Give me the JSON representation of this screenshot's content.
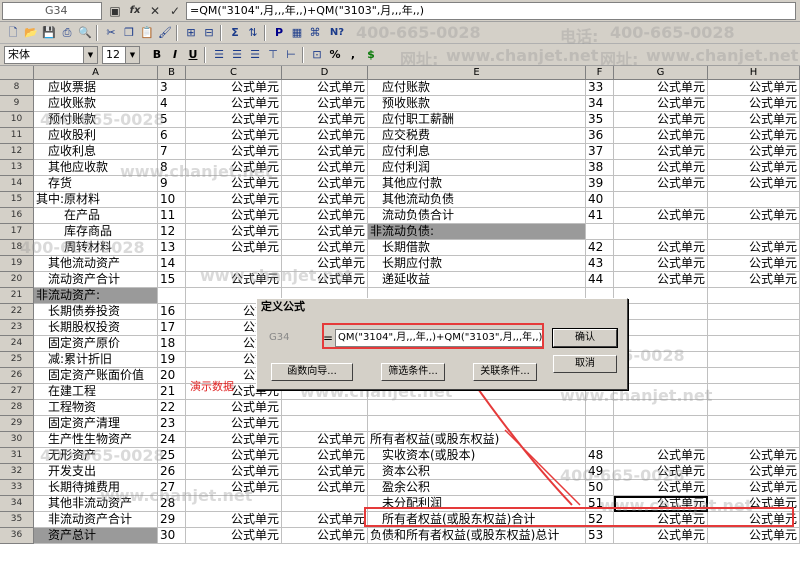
{
  "formula_bar": {
    "cell_ref": "G34",
    "fx_label": "fx",
    "cancel_label": "✕",
    "confirm_label": "✓",
    "formula": "=QM(\"3104\",月,,,年,,)+QM(\"3103\",月,,,年,,)"
  },
  "toolbar": {
    "font_name": "宋体",
    "font_size": "12",
    "bold": "B",
    "italic": "I",
    "underline": "U",
    "percent": "%",
    "comma": ",",
    "currency": "$",
    "sum": "Σ",
    "print_p": "P",
    "help": "N?"
  },
  "watermark": {
    "phone": "400-665-0028",
    "phone_label": "电话:",
    "site_label": "网址:",
    "site": "www.chanjet.net"
  },
  "columns": [
    "A",
    "B",
    "C",
    "D",
    "E",
    "F",
    "G",
    "H"
  ],
  "rows": [
    {
      "n": "8",
      "a": "应收票据",
      "ai": 1,
      "b": "3",
      "c": "公式单元",
      "d": "公式单元",
      "e": "应付账款",
      "ei": 1,
      "f": "33",
      "g": "公式单元",
      "h": "公式单元"
    },
    {
      "n": "9",
      "a": "应收账款",
      "ai": 1,
      "b": "4",
      "c": "公式单元",
      "d": "公式单元",
      "e": "预收账款",
      "ei": 1,
      "f": "34",
      "g": "公式单元",
      "h": "公式单元"
    },
    {
      "n": "10",
      "a": "预付账款",
      "ai": 1,
      "b": "5",
      "c": "公式单元",
      "d": "公式单元",
      "e": "应付职工薪酬",
      "ei": 1,
      "f": "35",
      "g": "公式单元",
      "h": "公式单元"
    },
    {
      "n": "11",
      "a": "应收股利",
      "ai": 1,
      "b": "6",
      "c": "公式单元",
      "d": "公式单元",
      "e": "应交税费",
      "ei": 1,
      "f": "36",
      "g": "公式单元",
      "h": "公式单元"
    },
    {
      "n": "12",
      "a": "应收利息",
      "ai": 1,
      "b": "7",
      "c": "公式单元",
      "d": "公式单元",
      "e": "应付利息",
      "ei": 1,
      "f": "37",
      "g": "公式单元",
      "h": "公式单元"
    },
    {
      "n": "13",
      "a": "其他应收款",
      "ai": 1,
      "b": "8",
      "c": "公式单元",
      "d": "公式单元",
      "e": "应付利润",
      "ei": 1,
      "f": "38",
      "g": "公式单元",
      "h": "公式单元"
    },
    {
      "n": "14",
      "a": "存货",
      "ai": 1,
      "b": "9",
      "c": "公式单元",
      "d": "公式单元",
      "e": "其他应付款",
      "ei": 1,
      "f": "39",
      "g": "公式单元",
      "h": "公式单元"
    },
    {
      "n": "15",
      "a": "其中:原材料",
      "ai": 0,
      "b": "10",
      "c": "公式单元",
      "d": "公式单元",
      "e": "其他流动负债",
      "ei": 1,
      "f": "40",
      "g": "",
      "h": ""
    },
    {
      "n": "16",
      "a": "在产品",
      "ai": 2,
      "b": "11",
      "c": "公式单元",
      "d": "公式单元",
      "e": "流动负债合计",
      "ei": 1,
      "f": "41",
      "g": "公式单元",
      "h": "公式单元"
    },
    {
      "n": "17",
      "a": "库存商品",
      "ai": 2,
      "b": "12",
      "c": "公式单元",
      "d": "公式单元",
      "e": "非流动负债:",
      "ei": 0,
      "eg": true,
      "f": "",
      "g": "",
      "h": ""
    },
    {
      "n": "18",
      "a": "周转材料",
      "ai": 2,
      "b": "13",
      "c": "公式单元",
      "d": "公式单元",
      "e": "长期借款",
      "ei": 1,
      "f": "42",
      "g": "公式单元",
      "h": "公式单元"
    },
    {
      "n": "19",
      "a": "其他流动资产",
      "ai": 1,
      "b": "14",
      "c": "",
      "d": "公式单元",
      "e": "长期应付款",
      "ei": 1,
      "f": "43",
      "g": "公式单元",
      "h": "公式单元"
    },
    {
      "n": "20",
      "a": "流动资产合计",
      "ai": 1,
      "b": "15",
      "c": "公式单元",
      "d": "公式单元",
      "e": "递延收益",
      "ei": 1,
      "f": "44",
      "g": "公式单元",
      "h": "公式单元"
    },
    {
      "n": "21",
      "a": "非流动资产:",
      "ai": 0,
      "ag": true,
      "b": "",
      "c": "",
      "d": "",
      "e": "",
      "ei": 0,
      "f": "",
      "g": "",
      "h": ""
    },
    {
      "n": "22",
      "a": "长期债券投资",
      "ai": 1,
      "b": "16",
      "c": "公式单",
      "d": "",
      "e": "",
      "ei": 0,
      "f": "",
      "g": "",
      "h": ""
    },
    {
      "n": "23",
      "a": "长期股权投资",
      "ai": 1,
      "b": "17",
      "c": "公式单",
      "d": "",
      "e": "",
      "ei": 0,
      "f": "",
      "g": "",
      "h": ""
    },
    {
      "n": "24",
      "a": "固定资产原价",
      "ai": 1,
      "b": "18",
      "c": "公式单",
      "d": "",
      "e": "",
      "ei": 0,
      "f": "",
      "g": "",
      "h": ""
    },
    {
      "n": "25",
      "a": "减:累计折旧",
      "ai": 1,
      "b": "19",
      "c": "公式单",
      "d": "",
      "e": "",
      "ei": 0,
      "f": "",
      "g": "",
      "h": ""
    },
    {
      "n": "26",
      "a": "固定资产账面价值",
      "ai": 1,
      "b": "20",
      "c": "公式单",
      "d": "",
      "e": "",
      "ei": 0,
      "f": "",
      "g": "",
      "h": ""
    },
    {
      "n": "27",
      "a": "在建工程",
      "ai": 1,
      "b": "21",
      "c": "公式单元",
      "d": "",
      "e": "",
      "ei": 0,
      "f": "",
      "g": "",
      "h": ""
    },
    {
      "n": "28",
      "a": "工程物资",
      "ai": 1,
      "b": "22",
      "c": "公式单元",
      "d": "",
      "e": "",
      "ei": 0,
      "f": "",
      "g": "",
      "h": ""
    },
    {
      "n": "29",
      "a": "固定资产清理",
      "ai": 1,
      "b": "23",
      "c": "公式单元",
      "d": "",
      "e": "",
      "ei": 0,
      "f": "",
      "g": "",
      "h": ""
    },
    {
      "n": "30",
      "a": "生产性生物资产",
      "ai": 1,
      "b": "24",
      "c": "公式单元",
      "d": "公式单元",
      "e": "所有者权益(或股东权益)",
      "ei": 0,
      "f": "",
      "g": "",
      "h": ""
    },
    {
      "n": "31",
      "a": "无形资产",
      "ai": 1,
      "b": "25",
      "c": "公式单元",
      "d": "公式单元",
      "e": "实收资本(或股本)",
      "ei": 1,
      "f": "48",
      "g": "公式单元",
      "h": "公式单元"
    },
    {
      "n": "32",
      "a": "开发支出",
      "ai": 1,
      "b": "26",
      "c": "公式单元",
      "d": "公式单元",
      "e": "资本公积",
      "ei": 1,
      "f": "49",
      "g": "公式单元",
      "h": "公式单元"
    },
    {
      "n": "33",
      "a": "长期待摊费用",
      "ai": 1,
      "b": "27",
      "c": "公式单元",
      "d": "公式单元",
      "e": "盈余公积",
      "ei": 1,
      "f": "50",
      "g": "公式单元",
      "h": "公式单元"
    },
    {
      "n": "34",
      "a": "其他非流动资产",
      "ai": 1,
      "b": "28",
      "c": "",
      "d": "",
      "e": "未分配利润",
      "ei": 1,
      "f": "51",
      "g": "公式单元",
      "h": "公式单元",
      "gsel": true
    },
    {
      "n": "35",
      "a": "非流动资产合计",
      "ai": 1,
      "b": "29",
      "c": "公式单元",
      "d": "公式单元",
      "e": "所有者权益(或股东权益)合计",
      "ei": 1,
      "f": "52",
      "g": "公式单元",
      "h": "公式单元"
    },
    {
      "n": "36",
      "a": "资产总计",
      "ai": 1,
      "ag": true,
      "b": "30",
      "c": "公式单元",
      "d": "公式单元",
      "e": "负债和所有者权益(或股东权益)总计",
      "ei": 0,
      "f": "53",
      "g": "公式单元",
      "h": "公式单元"
    }
  ],
  "demo_label": "演示数据",
  "dialog": {
    "title": "定义公式",
    "cell_ref": "G34",
    "equals": "=",
    "formula": "QM(\"3104\",月,,,年,,)+QM(\"3103\",月,,,年,,)",
    "ok": "确认",
    "cancel": "取消",
    "wizard": "函数向导...",
    "filter": "筛选条件...",
    "relation": "关联条件..."
  },
  "colors": {
    "highlight": "#e53a3a",
    "chrome": "#d4d0c8",
    "section_grey": "#9a9a9a"
  }
}
